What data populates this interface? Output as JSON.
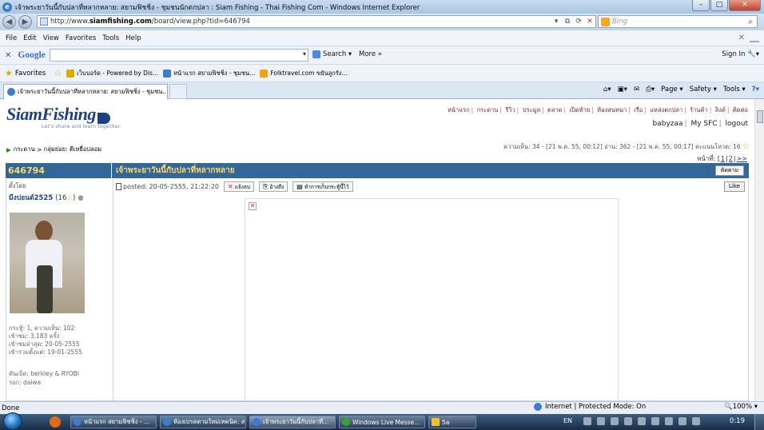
{
  "window": {
    "title": "เจ้าพระยาวันนี้กับปลาที่หลากหลาย: สยามฟิชชิ่ง - ชุมชนนักตกปลา : Siam Fishing - Thai Fishing Com - Windows Internet Explorer",
    "controls": {
      "minimize": "–",
      "maximize": "□",
      "close": "✕"
    }
  },
  "address_bar": {
    "url_prefix": "http://www.",
    "url_host": "siamfishing.com",
    "url_path": "/board/view.php?tid=646794",
    "search_placeholder": "Bing"
  },
  "menu": [
    "File",
    "Edit",
    "View",
    "Favorites",
    "Tools",
    "Help"
  ],
  "google_toolbar": {
    "logo": "Google",
    "search_label": "Search",
    "more_label": "More »",
    "sign_in": "Sign In"
  },
  "favorites_bar": {
    "label": "Favorites",
    "items": [
      "เว็บบอร์ด - Powered by Dis...",
      "หน้าแรก สยามฟิชชิ่ง - ชุมชน...",
      "Folktravel.com ขยันลูกรัง..."
    ]
  },
  "tab": {
    "title": "เจ้าพระยาวันนี้กับปลาที่หลากหลาย: สยามฟิชชิ่ง - ชุมชน...",
    "commands": [
      "Page ▾",
      "Safety ▾",
      "Tools ▾"
    ]
  },
  "site": {
    "brand": "SiamFishing",
    "tagline": "Let's share and learn together.",
    "nav": [
      "หน้าแรก",
      "กระดาน",
      "รีวิว",
      "ประมูล",
      "ตลาด",
      "เปิดท้าย",
      "ห้องสนทนา",
      "เรือ",
      "แหล่งตกปลา",
      "ร้านค้า",
      "ลิงค์",
      "ติดต่อ"
    ],
    "user": {
      "name": "babyzaa",
      "my_sfc": "My SFC",
      "logout": "logout"
    }
  },
  "breadcrumb": {
    "board": "กระดาน",
    "sep": ">",
    "group": "กลุ่มย่อย: ตีเหยื่อปลอม"
  },
  "thread_stats": "ความเห็น: 34 - [21 พ.ค. 55, 00:12] อ่าน: 362 - [21 พ.ค. 55, 00:17] คะแนนโหวต: 16",
  "pager": {
    "label": "หน้าที่:",
    "pages": [
      "1",
      "2"
    ],
    "next": ">>"
  },
  "thread": {
    "id": "646794",
    "title": "เจ้าพระยาวันนี้กับปลาที่หลากหลาย",
    "follow_label": "ติดตาม"
  },
  "post": {
    "posted_by_label": "ตั้งโดย",
    "author": "มีงปอนด์2525",
    "author_score": "(16",
    "author_score_close": ")",
    "posted": "posted: 20-05-2555, 21:22:20",
    "buttons": [
      "แจ้งลบ",
      "อ้างถึง",
      "ทำการเก็บกระทู้นี้ไว้"
    ],
    "like_label": "Like",
    "author_info": [
      "กระทู้: 1, ความเห็น: 102",
      "เข้าชม: 3,183 ครั้ง",
      "เข้าชมล่าสุด: 20-05-2555",
      "เข้าร่วมตั้งแต่: 19-01-2555"
    ],
    "author_extra": [
      "คันเบ็ด: berkley & RYOBI",
      "รอก: daiwa"
    ]
  },
  "status_bar": {
    "left": "Done",
    "zone": "Internet | Protected Mode: On",
    "zoom": "100%"
  },
  "taskbar": {
    "items": [
      "หน้าแรก สยามฟิชชิ่ง - ...",
      "ห้องเบรคตามใหม่เทคนิค: ส...",
      "เจ้าพระยาวันนี้กับปลาที่...",
      "Windows Live Messe...",
      "5a"
    ],
    "lang": "EN",
    "clock": "0:19"
  }
}
